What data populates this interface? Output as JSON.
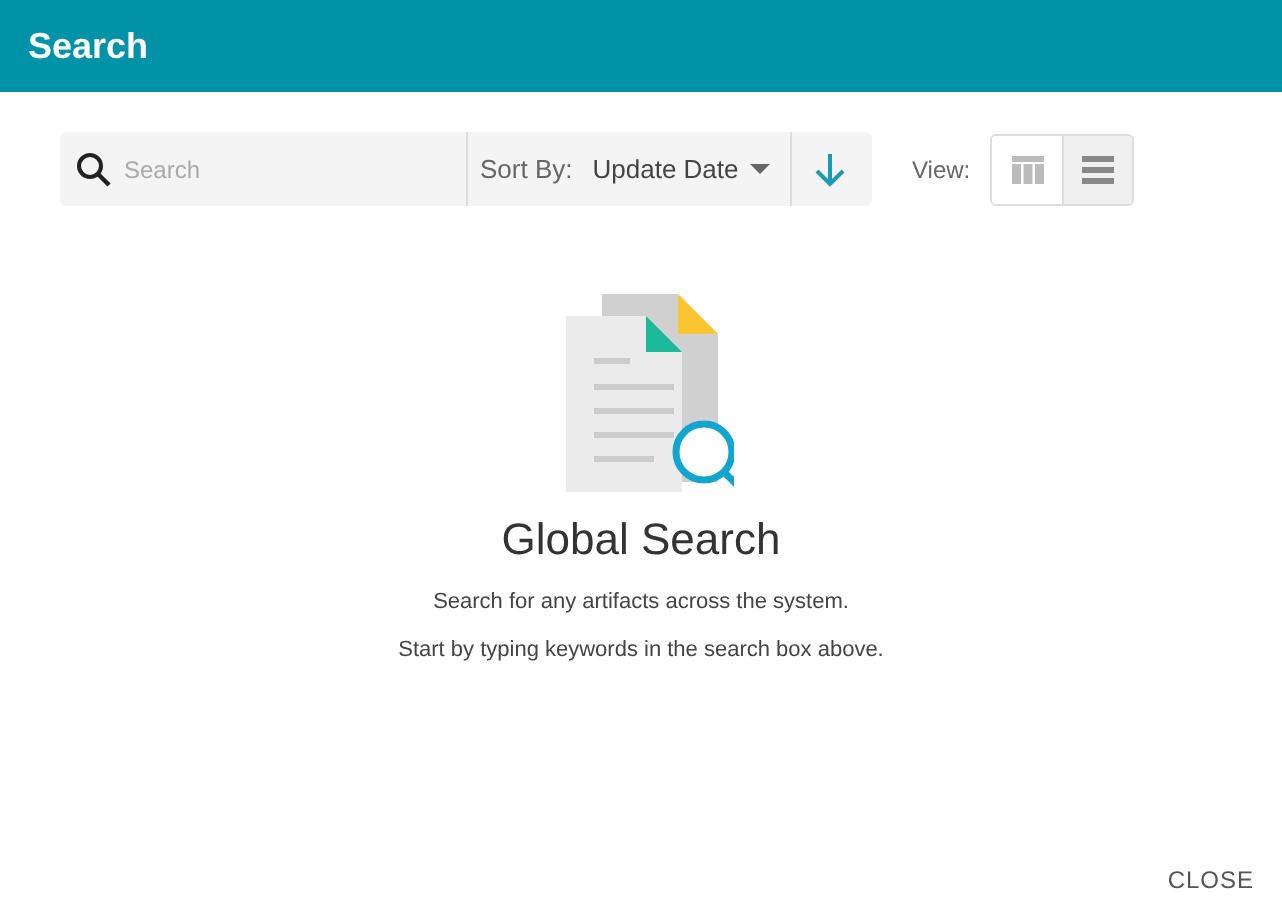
{
  "window": {
    "title": "Search"
  },
  "search": {
    "placeholder": "Search"
  },
  "sort": {
    "label": "Sort By:",
    "value": "Update Date"
  },
  "view": {
    "label": "View:",
    "options": [
      {
        "kind": "grid",
        "selected": false
      },
      {
        "kind": "list",
        "selected": true
      }
    ]
  },
  "empty_state": {
    "title": "Global Search",
    "lines": [
      "Search for any artifacts across the system.",
      "Start by typing keywords in the search box above."
    ]
  },
  "buttons": [
    "CLOSE"
  ]
}
